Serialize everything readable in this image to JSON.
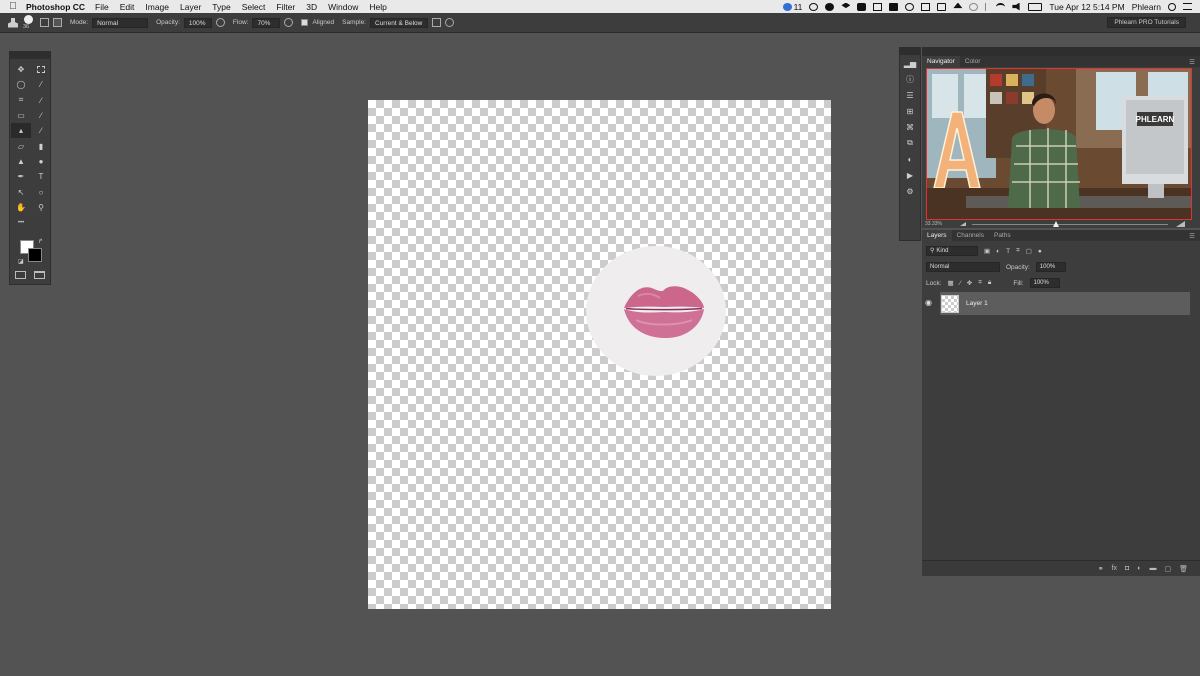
{
  "menubar": {
    "apple_icon": "apple-icon",
    "app_name": "Photoshop CC",
    "items": [
      "File",
      "Edit",
      "Image",
      "Layer",
      "Type",
      "Select",
      "Filter",
      "3D",
      "Window",
      "Help"
    ],
    "badge_count": "11",
    "clock": "Tue Apr 12  5:14 PM",
    "user": "Phlearn"
  },
  "options": {
    "brush_size": "36",
    "mode_label": "Mode:",
    "mode_value": "Normal",
    "opacity_label": "Opacity:",
    "opacity_value": "100%",
    "flow_label": "Flow:",
    "flow_value": "70%",
    "aligned_label": "Aligned",
    "sample_label": "Sample:",
    "sample_value": "Current & Below",
    "workspace": "Phlearn PRO Tutorials"
  },
  "tools": {
    "more": "•••"
  },
  "navigator": {
    "tabs": [
      "Navigator",
      "Color"
    ],
    "zoom": "33.33%",
    "sign_text": "PHLEARN"
  },
  "layers": {
    "tabs": [
      "Layers",
      "Channels",
      "Paths"
    ],
    "filter_kind": "Kind",
    "blend_mode": "Normal",
    "opacity_label": "Opacity:",
    "opacity_value": "100%",
    "lock_label": "Lock:",
    "fill_label": "Fill:",
    "fill_value": "100%",
    "items": [
      {
        "name": "Layer 1",
        "visible": true
      }
    ]
  },
  "colors": {
    "ui_dark": "#3d3d3d",
    "workspace_bg": "#535353",
    "lip_color": "#c85680"
  }
}
